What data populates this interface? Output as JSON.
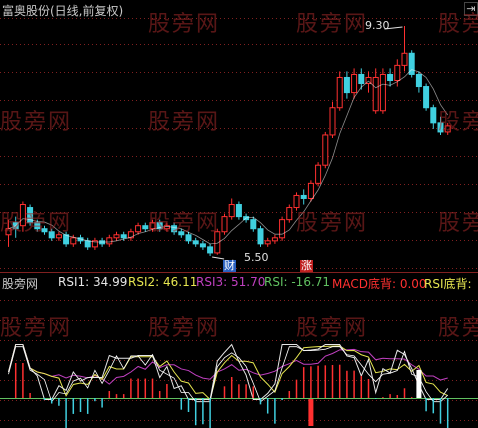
{
  "chart_title": "富奥股份(日线,前复权)",
  "scroll_button": "⇥",
  "price_chart": {
    "high_label": "9.30",
    "low_label": "5.50",
    "marker_cai": "财",
    "marker_zhang": "涨",
    "candles": [
      [
        5.85,
        5.95,
        5.65,
        6.1,
        "up"
      ],
      [
        5.95,
        6.05,
        5.8,
        6.15,
        "down"
      ],
      [
        6.0,
        6.35,
        5.9,
        6.4,
        "up"
      ],
      [
        6.3,
        6.05,
        6.0,
        6.35,
        "down"
      ],
      [
        6.05,
        5.95,
        5.9,
        6.1,
        "down"
      ],
      [
        5.95,
        5.9,
        5.85,
        6.0,
        "down"
      ],
      [
        5.9,
        5.8,
        5.75,
        5.95,
        "down"
      ],
      [
        5.8,
        5.85,
        5.75,
        5.9,
        "up"
      ],
      [
        5.85,
        5.7,
        5.65,
        5.9,
        "down"
      ],
      [
        5.7,
        5.8,
        5.65,
        5.85,
        "up"
      ],
      [
        5.8,
        5.75,
        5.7,
        5.85,
        "down"
      ],
      [
        5.75,
        5.65,
        5.6,
        5.8,
        "down"
      ],
      [
        5.65,
        5.75,
        5.6,
        5.8,
        "up"
      ],
      [
        5.75,
        5.7,
        5.65,
        5.8,
        "down"
      ],
      [
        5.7,
        5.8,
        5.65,
        5.85,
        "up"
      ],
      [
        5.8,
        5.85,
        5.75,
        5.9,
        "up"
      ],
      [
        5.85,
        5.8,
        5.75,
        5.9,
        "down"
      ],
      [
        5.8,
        5.9,
        5.75,
        5.95,
        "up"
      ],
      [
        5.9,
        6.0,
        5.85,
        6.05,
        "up"
      ],
      [
        6.0,
        5.95,
        5.9,
        6.05,
        "down"
      ],
      [
        5.95,
        6.05,
        5.9,
        6.1,
        "up"
      ],
      [
        6.05,
        5.95,
        5.9,
        6.1,
        "down"
      ],
      [
        5.95,
        6.0,
        5.9,
        6.05,
        "up"
      ],
      [
        6.0,
        5.9,
        5.85,
        6.05,
        "down"
      ],
      [
        5.9,
        5.85,
        5.8,
        5.95,
        "down"
      ],
      [
        5.85,
        5.75,
        5.7,
        5.9,
        "down"
      ],
      [
        5.75,
        5.7,
        5.65,
        5.8,
        "down"
      ],
      [
        5.7,
        5.65,
        5.6,
        5.75,
        "down"
      ],
      [
        5.65,
        5.55,
        5.5,
        5.7,
        "down"
      ],
      [
        5.55,
        5.9,
        5.52,
        5.95,
        "up"
      ],
      [
        5.9,
        6.15,
        5.85,
        6.2,
        "up"
      ],
      [
        6.15,
        6.35,
        6.1,
        6.45,
        "up"
      ],
      [
        6.35,
        6.15,
        6.1,
        6.4,
        "down"
      ],
      [
        6.15,
        6.1,
        6.05,
        6.2,
        "down"
      ],
      [
        6.1,
        5.95,
        5.9,
        6.15,
        "down"
      ],
      [
        5.95,
        5.7,
        5.65,
        6.0,
        "down"
      ],
      [
        5.7,
        5.75,
        5.65,
        5.8,
        "up"
      ],
      [
        5.75,
        5.8,
        5.7,
        5.85,
        "up"
      ],
      [
        5.8,
        6.1,
        5.75,
        6.15,
        "up"
      ],
      [
        6.1,
        6.3,
        6.05,
        6.35,
        "up"
      ],
      [
        6.3,
        6.5,
        6.25,
        6.55,
        "up"
      ],
      [
        6.5,
        6.45,
        6.35,
        6.6,
        "down"
      ],
      [
        6.45,
        6.7,
        6.4,
        6.75,
        "up"
      ],
      [
        6.7,
        7.0,
        6.65,
        7.05,
        "up"
      ],
      [
        7.0,
        7.5,
        6.95,
        7.55,
        "up"
      ],
      [
        7.5,
        7.95,
        7.45,
        8.05,
        "up"
      ],
      [
        7.95,
        8.45,
        7.9,
        8.55,
        "up"
      ],
      [
        8.45,
        8.2,
        8.1,
        8.55,
        "down"
      ],
      [
        8.2,
        8.5,
        8.1,
        8.6,
        "up"
      ],
      [
        8.5,
        8.35,
        8.25,
        8.6,
        "down"
      ],
      [
        8.35,
        8.45,
        8.2,
        8.55,
        "up"
      ],
      [
        8.45,
        7.9,
        7.85,
        8.6,
        "up"
      ],
      [
        7.9,
        8.5,
        7.85,
        8.6,
        "up"
      ],
      [
        8.5,
        8.4,
        8.3,
        8.6,
        "down"
      ],
      [
        8.4,
        8.65,
        8.3,
        8.75,
        "up"
      ],
      [
        8.65,
        8.85,
        8.55,
        9.3,
        "up"
      ],
      [
        8.85,
        8.5,
        8.45,
        8.9,
        "down"
      ],
      [
        8.5,
        8.3,
        8.2,
        8.55,
        "down"
      ],
      [
        8.3,
        7.95,
        7.9,
        8.35,
        "down"
      ],
      [
        7.95,
        7.7,
        7.6,
        8.0,
        "down"
      ],
      [
        7.7,
        7.55,
        7.5,
        7.8,
        "down"
      ],
      [
        7.55,
        7.65,
        7.5,
        7.7,
        "up"
      ]
    ]
  },
  "indicator": {
    "name": "股旁网",
    "rsi1_label": "RSI1: 34.99",
    "rsi2_label": "RSI2: 46.11",
    "rsi3_label": "RSI3: 51.70",
    "rsi_label": "RSI: -16.71",
    "macd_label": "MACD底背: 0.00",
    "rsi_bottom_label": "RSI底背:",
    "colors": {
      "rsi1": "#e6e6e6",
      "rsi2": "#e6e650",
      "rsi3": "#c040c0",
      "rsi": "#60c060",
      "macd": "#ff3030",
      "rsi_bottom": "#e6e650",
      "up": "#ff3030",
      "down": "#40d0e0",
      "grid": "#802020",
      "ma": "#ffffff"
    }
  },
  "watermark": "股旁网"
}
